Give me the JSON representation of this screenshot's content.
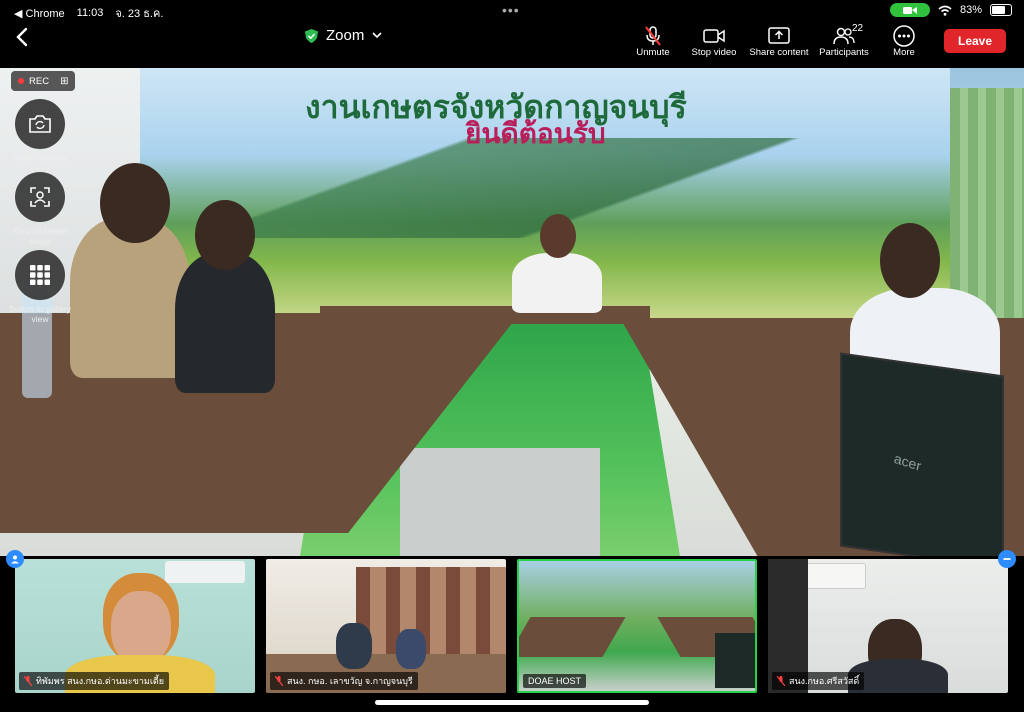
{
  "status": {
    "back_app": "◀ Chrome",
    "time": "11:03",
    "date": "จ. 23 ธ.ค.",
    "battery": "83%",
    "battery_level": 0.83
  },
  "toolbar": {
    "title": "Zoom",
    "tools": [
      {
        "label": "Unmute",
        "icon": "mic-muted-icon"
      },
      {
        "label": "Stop video",
        "icon": "video-camera-icon"
      },
      {
        "label": "Share content",
        "icon": "share-upload-icon"
      },
      {
        "label": "Participants",
        "icon": "participants-icon",
        "badge": "22"
      },
      {
        "label": "More",
        "icon": "more-dots-icon"
      }
    ],
    "leave_label": "Leave"
  },
  "stage": {
    "banner_line1": "งานเกษตรจังหวัดกาญจนบุรี",
    "banner_line2": "ยินดีต้อนรับ",
    "laptop_brand": "acer"
  },
  "overlay": {
    "rec_label": "REC",
    "controls": [
      {
        "label": "Switch camera",
        "icon": "camera-switch-icon"
      },
      {
        "label": "Turn off center stage",
        "icon": "center-stage-icon"
      },
      {
        "label": "Switch to gallery view",
        "icon": "gallery-grid-icon"
      }
    ]
  },
  "thumbnails": [
    {
      "name": "ทิพัมพร สนง.กษอ.ด่านมะขามเตี้ย",
      "muted": true
    },
    {
      "name": "สนง. กษอ. เลาขวัญ จ.กาญจนบุรี",
      "muted": true
    },
    {
      "name": "DOAE HOST",
      "muted": false,
      "active": true
    },
    {
      "name": "สนง.กษอ.ศรีสวัสดิ์",
      "muted": true
    }
  ],
  "colors": {
    "leave": "#e0262b",
    "active_speaker": "#27d14a",
    "badge_blue": "#2d8cff"
  }
}
